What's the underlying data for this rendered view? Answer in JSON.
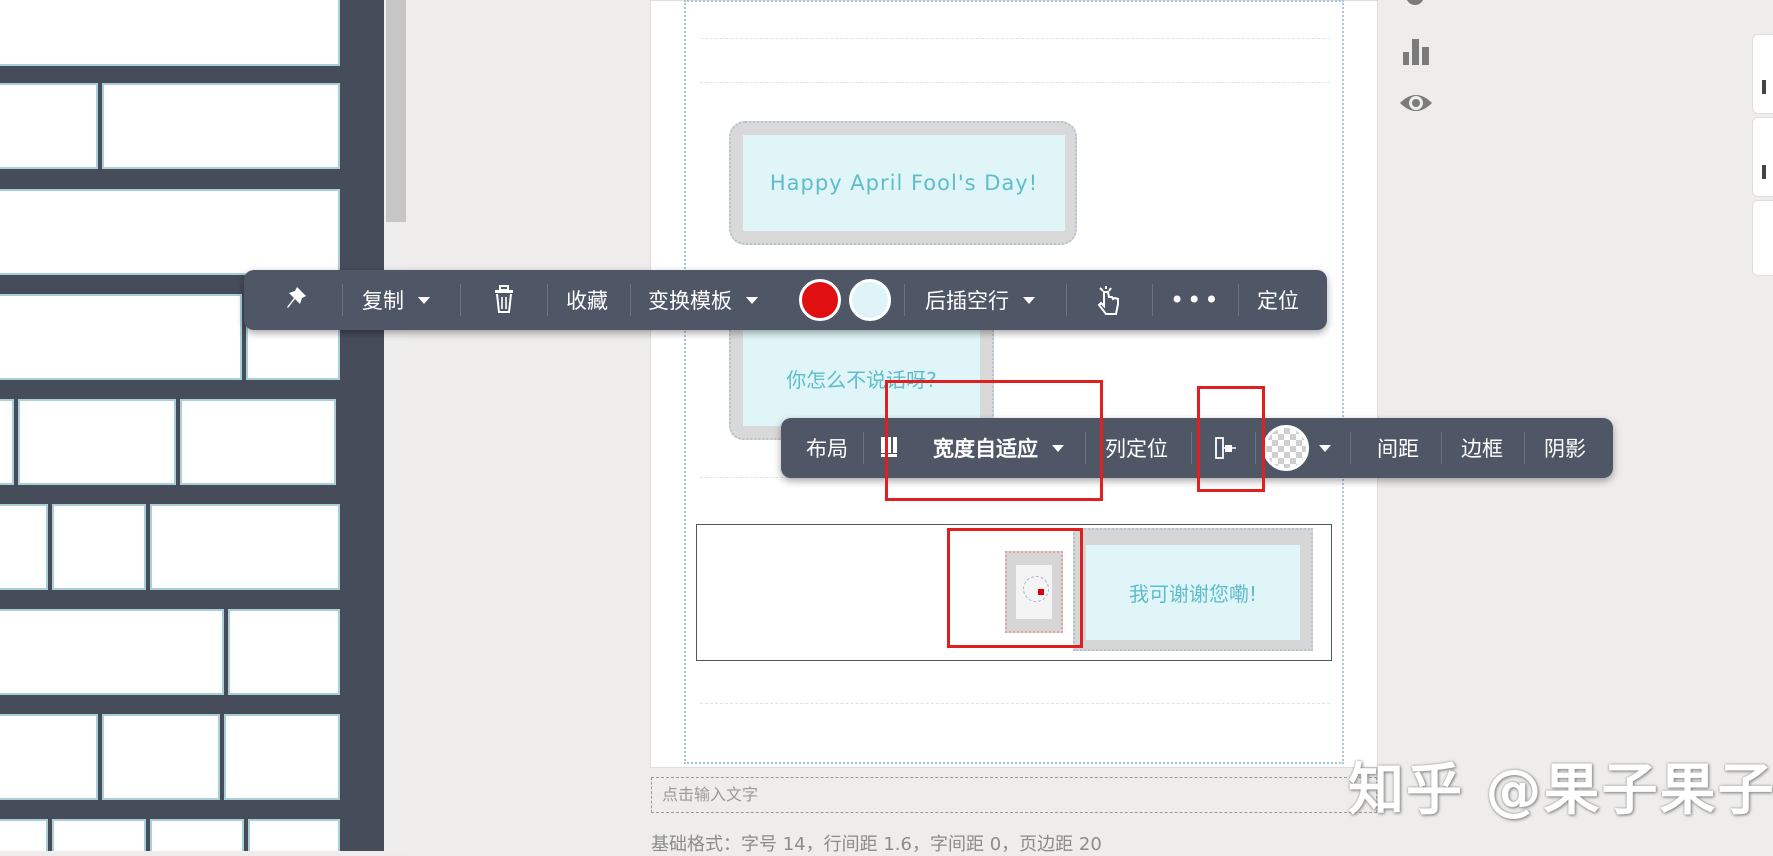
{
  "toolbar_top": {
    "copy_label": "复制",
    "favorite_label": "收藏",
    "change_template_label": "变换模板",
    "insert_after_label": "后插空行",
    "more_label": "•••",
    "position_label": "定位",
    "color_primary": "#e11010",
    "color_secondary": "#dff4f8"
  },
  "toolbar_bottom": {
    "layout_label": "布局",
    "width_adaptive_label": "宽度自适应",
    "column_position_label": "列定位",
    "spacing_label": "间距",
    "border_label": "边框",
    "shadow_label": "阴影"
  },
  "editor": {
    "bubble1_text": "Happy April Fool's Day!",
    "bubble2_text": "你怎么不说话呀?",
    "bubble3_text": "我可谢谢您嘞!",
    "input_placeholder": "点击输入文字",
    "base_format": "基础格式：字号 14，行间距 1.6，字间距 0，页边距 20"
  },
  "watermark": "知乎 @果子果子",
  "colors": {
    "toolbar_bg": "#4f5767",
    "left_panel_bg": "#464c5a",
    "tile_border": "#a9d0d8",
    "bubble_text": "#5fbdcb",
    "highlight": "#e02020"
  }
}
